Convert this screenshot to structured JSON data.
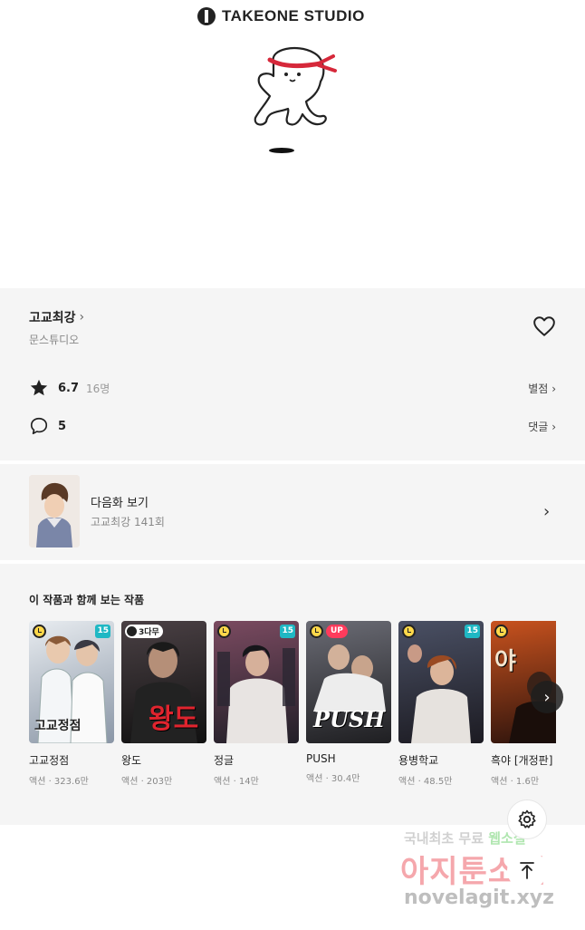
{
  "banner": {
    "brand": "TAKEONE STUDIO"
  },
  "work": {
    "title": "고교최강",
    "author": "문스튜디오",
    "rating": "6.7",
    "rating_count": "16명",
    "rating_link": "별점",
    "comments": "5",
    "comments_link": "댓글"
  },
  "next_episode": {
    "label": "다음화 보기",
    "subtitle": "고교최강 141회"
  },
  "recommend": {
    "heading": "이 작품과 함께 보는 작품",
    "items": [
      {
        "title": "고교정점",
        "meta": "액션 · 323.6만",
        "age": "15",
        "cover_text": "고교정점",
        "colors": [
          "#dfe3e8",
          "#8a96a6"
        ]
      },
      {
        "title": "왕도",
        "meta": "액션 · 203만",
        "badge": "3다무",
        "cover_text": "왕도",
        "colors": [
          "#3a3438",
          "#111111"
        ]
      },
      {
        "title": "정글",
        "meta": "액션 · 14만",
        "age": "15",
        "colors": [
          "#6a3f52",
          "#2a2630"
        ]
      },
      {
        "title": "PUSH",
        "meta": "액션 · 30.4만",
        "badge_up": "UP",
        "cover_text": "PUSH",
        "colors": [
          "#5d5e66",
          "#1f1f22"
        ]
      },
      {
        "title": "용병학교",
        "meta": "액션 · 48.5만",
        "age": "15",
        "colors": [
          "#3f4556",
          "#1c1b22"
        ]
      },
      {
        "title": "흑야 [개정판]",
        "meta": "액션 · 1.6만",
        "cover_text": "야",
        "colors": [
          "#b8461e",
          "#2a120c"
        ]
      }
    ]
  },
  "icons": {
    "chevron": "chevron-right-icon",
    "heart": "heart-outline-icon",
    "star": "star-icon",
    "comment": "comment-bubble-icon",
    "settings": "gear-icon",
    "top": "arrow-up-icon"
  },
  "watermark": {
    "line1_a": "국내최초 무료 ",
    "line1_b": "웹소설",
    "line2": "아지툰소설",
    "line3": "novelagit.xyz"
  }
}
